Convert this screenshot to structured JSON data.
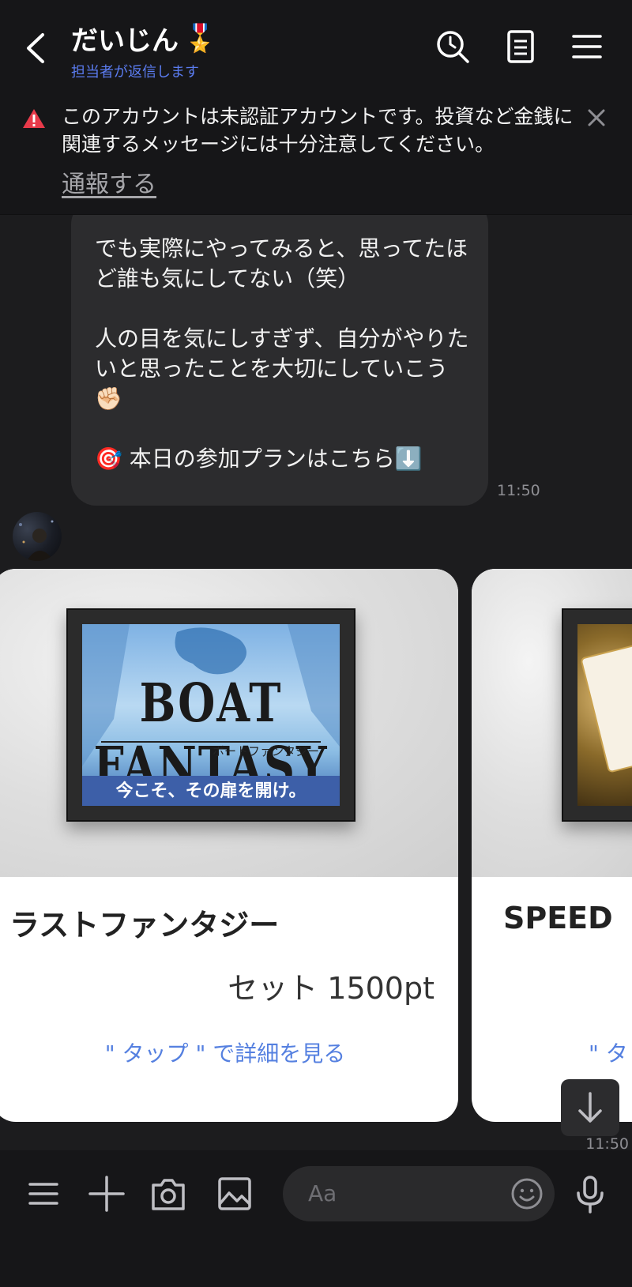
{
  "header": {
    "title": "だいじん",
    "title_badge": "🎖️",
    "subtitle": "担当者が返信します"
  },
  "banner": {
    "text": "このアカウントは未認証アカウントです。投資など金銭に関連するメッセージには十分注意してください。",
    "report_label": "通報する"
  },
  "messages": [
    {
      "text": "でも実際にやってみると、思ってたほど誰も気にしてない（笑）\n\n人の目を気にしすぎず、自分がやりたいと思ったことを大切にしていこう✊🏻\n\n🎯 本日の参加プランはこちら⬇️",
      "time": "11:50"
    }
  ],
  "carousel": {
    "time": "11:50",
    "cards": [
      {
        "image_title": "BOAT FANTASY",
        "image_subtitle": "ボートファンタジー",
        "image_tagline": "今こそ、その扉を開け。",
        "title": "ラストファンタジー",
        "price": "セット 1500pt",
        "link": "\" タップ \" で詳細を見る"
      },
      {
        "title": "SPEED",
        "link": "\" タ"
      }
    ]
  },
  "input": {
    "placeholder": "Aa"
  },
  "colors": {
    "accent": "#5580e0",
    "subtitle": "#5b7cf0",
    "warning": "#e83a4a",
    "background": "#1c1c1e",
    "bubble": "#2c2c2e"
  },
  "icons": {
    "header": [
      "back-icon",
      "search-icon",
      "notes-icon",
      "menu-icon"
    ],
    "bottom": [
      "menu-icon",
      "plus-icon",
      "camera-icon",
      "image-icon",
      "emoji-icon",
      "mic-icon"
    ]
  }
}
